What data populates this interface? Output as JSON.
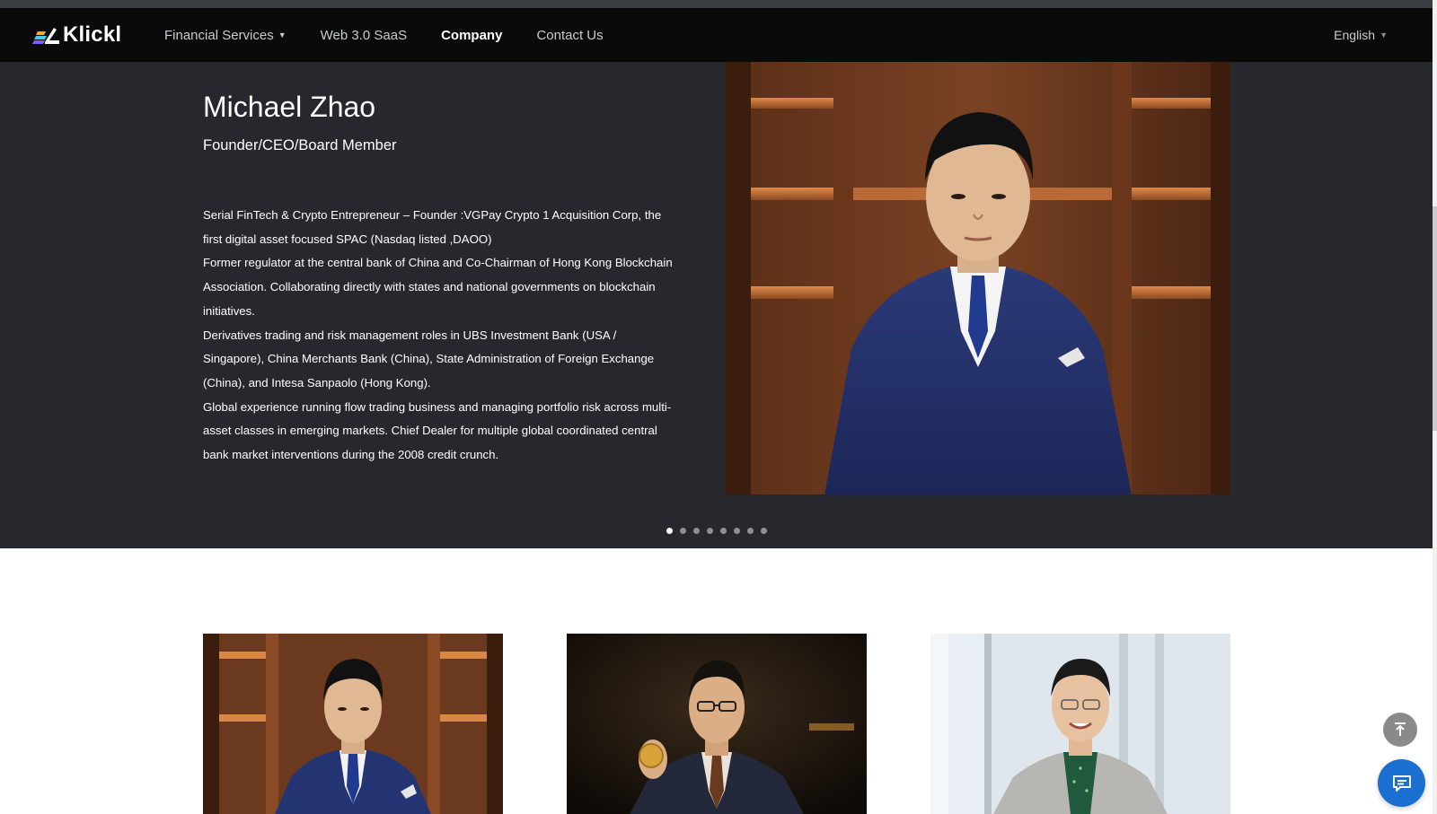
{
  "brand": {
    "name": "Klickl"
  },
  "nav": {
    "items": [
      {
        "label": "Financial Services",
        "has_dropdown": true
      },
      {
        "label": "Web 3.0 SaaS"
      },
      {
        "label": "Company",
        "active": true
      },
      {
        "label": "Contact Us"
      }
    ],
    "language": "English"
  },
  "hero": {
    "name": "Michael Zhao",
    "role": "Founder/CEO/Board Member",
    "bio": [
      "Serial FinTech & Crypto Entrepreneur – Founder :VGPay Crypto 1 Acquisition Corp, the first digital asset focused SPAC (Nasdaq listed ,DAOO)",
      "Former regulator at the central bank of China and Co-Chairman of Hong Kong Blockchain Association. Collaborating directly with states and national governments on blockchain initiatives.",
      "Derivatives trading and risk management roles in UBS Investment Bank (USA / Singapore), China Merchants Bank (China), State Administration of Foreign Exchange (China), and Intesa Sanpaolo (Hong Kong).",
      "Global experience running flow trading business and managing portfolio risk across multi-asset classes in emerging markets. Chief Dealer for multiple global coordinated central bank market interventions during the 2008 credit crunch."
    ],
    "slide_count": 8,
    "active_slide": 1
  },
  "colors": {
    "navbar_bg": "#0a0a0b",
    "hero_bg": "#26282e",
    "accent_blue": "#1a6fd1"
  },
  "icons": {
    "back_to_top": "arrow-up-to-line-icon",
    "chat": "chat-bubble-icon"
  }
}
